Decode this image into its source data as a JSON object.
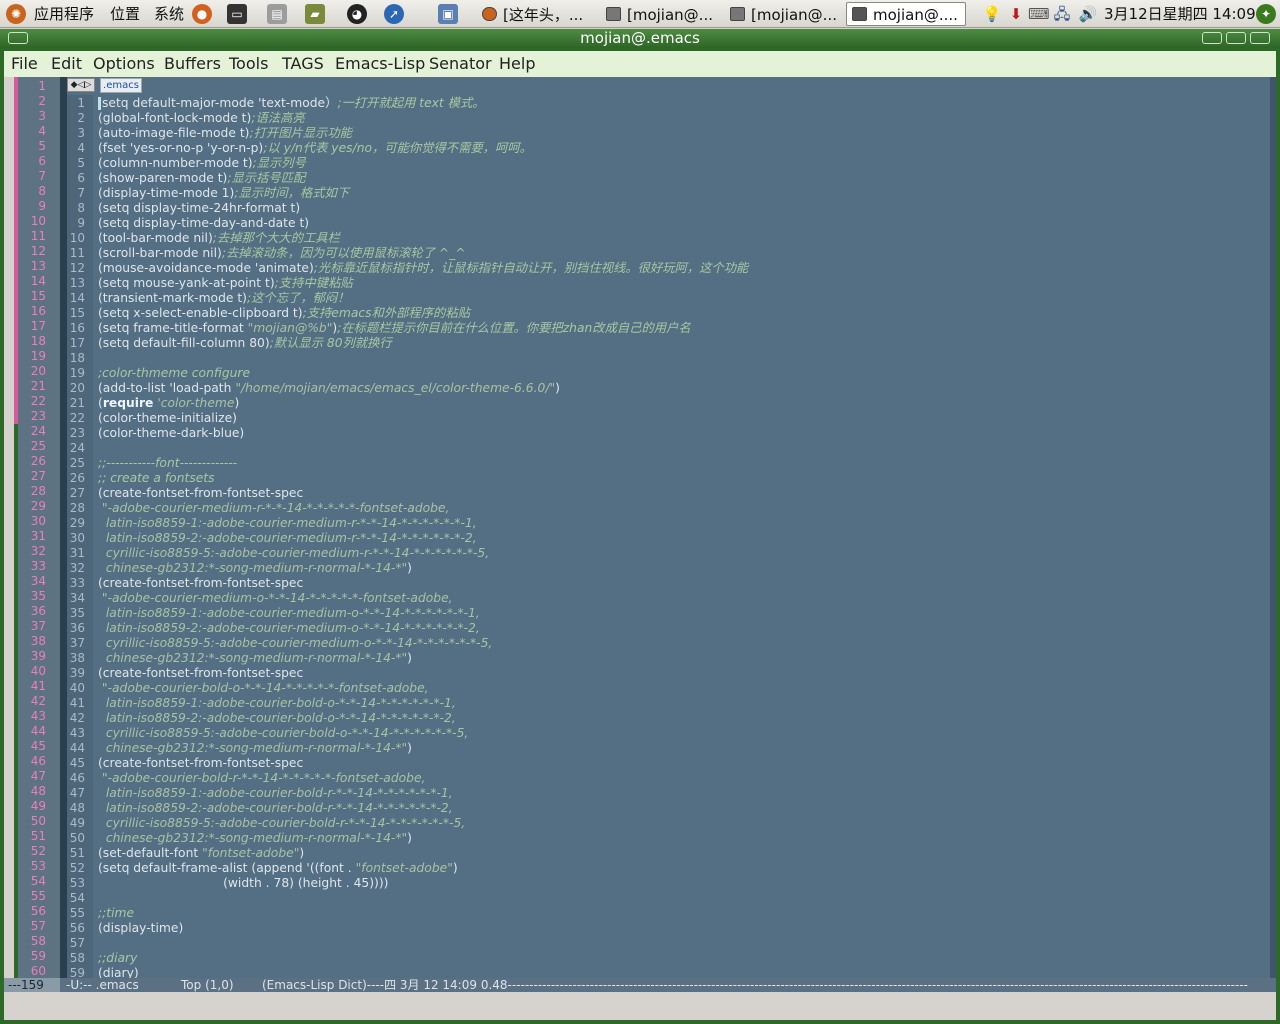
{
  "panel": {
    "apps_label": "应用程序",
    "places_label": "位置",
    "system_label": "系统",
    "tasks": [
      {
        "label": "[这年头，..."
      },
      {
        "label": "[mojian@..."
      },
      {
        "label": "[mojian@..."
      },
      {
        "label": "mojian@...."
      }
    ],
    "clock": "3月12日星期四 14:09"
  },
  "window": {
    "title": "mojian@.emacs"
  },
  "menubar": {
    "items": [
      "File",
      "Edit",
      "Options",
      "Buffers",
      "Tools",
      "TAGS",
      "Emacs-Lisp",
      "Senator",
      "Help"
    ]
  },
  "tab": {
    "label": ".emacs"
  },
  "outer_line_numbers": [
    "1",
    "2",
    "3",
    "4",
    "5",
    "6",
    "7",
    "8",
    "9",
    "10",
    "11",
    "12",
    "13",
    "14",
    "15",
    "16",
    "17",
    "18",
    "19",
    "20",
    "21",
    "22",
    "23",
    "24",
    "25",
    "26",
    "27",
    "28",
    "29",
    "30",
    "31",
    "32",
    "33",
    "34",
    "35",
    "36",
    "37",
    "38",
    "39",
    "40",
    "41",
    "42",
    "43",
    "44",
    "45",
    "46",
    "47",
    "48",
    "49",
    "50",
    "51",
    "52",
    "53",
    "54",
    "55",
    "56",
    "57",
    "58",
    "59",
    "60"
  ],
  "lines": [
    {
      "n": "1",
      "seg": [
        [
          "",
          "setq default-major-mode 'text-mode"
        ],
        [
          "",
          "）"
        ],
        [
          "cmt",
          ";一打开就起用 text 模式。"
        ]
      ]
    },
    {
      "n": "2",
      "seg": [
        [
          "",
          "(global-font-lock-mode t)"
        ],
        [
          "cmt",
          ";语法高亮"
        ]
      ]
    },
    {
      "n": "3",
      "seg": [
        [
          "",
          "(auto-image-file-mode t)"
        ],
        [
          "cmt",
          ";打开图片显示功能"
        ]
      ]
    },
    {
      "n": "4",
      "seg": [
        [
          "",
          "(fset 'yes-or-no-p 'y-or-n-p)"
        ],
        [
          "cmt",
          ";以 y/n代表 yes/no，可能你觉得不需要，呵呵。"
        ]
      ]
    },
    {
      "n": "5",
      "seg": [
        [
          "",
          "(column-number-mode t)"
        ],
        [
          "cmt",
          ";显示列号"
        ]
      ]
    },
    {
      "n": "6",
      "seg": [
        [
          "",
          "(show-paren-mode t)"
        ],
        [
          "cmt",
          ";显示括号匹配"
        ]
      ]
    },
    {
      "n": "7",
      "seg": [
        [
          "",
          "(display-time-mode 1)"
        ],
        [
          "cmt",
          ";显示时间，格式如下"
        ]
      ]
    },
    {
      "n": "8",
      "seg": [
        [
          "",
          "(setq display-time-24hr-format t)"
        ]
      ]
    },
    {
      "n": "9",
      "seg": [
        [
          "",
          "(setq display-time-day-and-date t)"
        ]
      ]
    },
    {
      "n": "10",
      "seg": [
        [
          "",
          "(tool-bar-mode nil)"
        ],
        [
          "cmt",
          ";去掉那个大大的工具栏"
        ]
      ]
    },
    {
      "n": "11",
      "seg": [
        [
          "",
          "(scroll-bar-mode nil)"
        ],
        [
          "cmt",
          ";去掉滚动条，因为可以使用鼠标滚轮了 ^_^"
        ]
      ]
    },
    {
      "n": "12",
      "seg": [
        [
          "",
          "(mouse-avoidance-mode 'animate)"
        ],
        [
          "cmt",
          ";光标靠近鼠标指针时，让鼠标指针自动让开，别挡住视线。很好玩阿，这个功能"
        ]
      ]
    },
    {
      "n": "13",
      "seg": [
        [
          "",
          "(setq mouse-yank-at-point t)"
        ],
        [
          "cmt",
          ";支持中键粘贴"
        ]
      ]
    },
    {
      "n": "14",
      "seg": [
        [
          "",
          "(transient-mark-mode t)"
        ],
        [
          "cmt",
          ";这个忘了，郁闷！"
        ]
      ]
    },
    {
      "n": "15",
      "seg": [
        [
          "",
          "(setq x-select-enable-clipboard t)"
        ],
        [
          "cmt",
          ";支持emacs和外部程序的粘贴"
        ]
      ]
    },
    {
      "n": "16",
      "seg": [
        [
          "",
          "(setq frame-title-format "
        ],
        [
          "str",
          "\"mojian@%b\""
        ],
        [
          "",
          ")"
        ],
        [
          "cmt",
          ";在标题栏提示你目前在什么位置。你要把zhan改成自己的用户名"
        ]
      ]
    },
    {
      "n": "17",
      "seg": [
        [
          "",
          "(setq default-fill-column 80)"
        ],
        [
          "cmt",
          ";默认显示 80列就换行"
        ]
      ]
    },
    {
      "n": "18",
      "seg": []
    },
    {
      "n": "19",
      "seg": [
        [
          "cmt",
          ";color-thmeme configure"
        ]
      ]
    },
    {
      "n": "20",
      "seg": [
        [
          "",
          "(add-to-list 'load-path "
        ],
        [
          "str",
          "\"/home/mojian/emacs/emacs_el/color-theme-6.6.0/\""
        ],
        [
          "",
          ")"
        ]
      ]
    },
    {
      "n": "21",
      "seg": [
        [
          "",
          "("
        ],
        [
          "kw",
          "require"
        ],
        [
          "str",
          " 'color-theme"
        ],
        [
          "",
          ")"
        ]
      ]
    },
    {
      "n": "22",
      "seg": [
        [
          "",
          "(color-theme-initialize)"
        ]
      ]
    },
    {
      "n": "23",
      "seg": [
        [
          "",
          "(color-theme-dark-blue)"
        ]
      ]
    },
    {
      "n": "24",
      "seg": []
    },
    {
      "n": "25",
      "seg": [
        [
          "cmt",
          ";;-----------font-------------"
        ]
      ]
    },
    {
      "n": "26",
      "seg": [
        [
          "cmt",
          ";; create a fontsets"
        ]
      ]
    },
    {
      "n": "27",
      "seg": [
        [
          "",
          "(create-fontset-from-fontset-spec"
        ]
      ]
    },
    {
      "n": "28",
      "seg": [
        [
          "str",
          " \"-adobe-courier-medium-r-*-*-14-*-*-*-*-*-fontset-adobe,"
        ]
      ]
    },
    {
      "n": "29",
      "seg": [
        [
          "str",
          "  latin-iso8859-1:-adobe-courier-medium-r-*-*-14-*-*-*-*-*-*-1,"
        ]
      ]
    },
    {
      "n": "30",
      "seg": [
        [
          "str",
          "  latin-iso8859-2:-adobe-courier-medium-r-*-*-14-*-*-*-*-*-*-2,"
        ]
      ]
    },
    {
      "n": "31",
      "seg": [
        [
          "str",
          "  cyrillic-iso8859-5:-adobe-courier-medium-r-*-*-14-*-*-*-*-*-*-5,"
        ]
      ]
    },
    {
      "n": "32",
      "seg": [
        [
          "str",
          "  chinese-gb2312:*-song-medium-r-normal-*-14-*\""
        ],
        [
          "",
          ")"
        ]
      ]
    },
    {
      "n": "33",
      "seg": [
        [
          "",
          "(create-fontset-from-fontset-spec"
        ]
      ]
    },
    {
      "n": "34",
      "seg": [
        [
          "str",
          " \"-adobe-courier-medium-o-*-*-14-*-*-*-*-*-fontset-adobe,"
        ]
      ]
    },
    {
      "n": "35",
      "seg": [
        [
          "str",
          "  latin-iso8859-1:-adobe-courier-medium-o-*-*-14-*-*-*-*-*-*-1,"
        ]
      ]
    },
    {
      "n": "36",
      "seg": [
        [
          "str",
          "  latin-iso8859-2:-adobe-courier-medium-o-*-*-14-*-*-*-*-*-*-2,"
        ]
      ]
    },
    {
      "n": "37",
      "seg": [
        [
          "str",
          "  cyrillic-iso8859-5:-adobe-courier-medium-o-*-*-14-*-*-*-*-*-*-5,"
        ]
      ]
    },
    {
      "n": "38",
      "seg": [
        [
          "str",
          "  chinese-gb2312:*-song-medium-r-normal-*-14-*\""
        ],
        [
          "",
          ")"
        ]
      ]
    },
    {
      "n": "39",
      "seg": [
        [
          "",
          "(create-fontset-from-fontset-spec"
        ]
      ]
    },
    {
      "n": "40",
      "seg": [
        [
          "str",
          " \"-adobe-courier-bold-o-*-*-14-*-*-*-*-*-fontset-adobe,"
        ]
      ]
    },
    {
      "n": "41",
      "seg": [
        [
          "str",
          "  latin-iso8859-1:-adobe-courier-bold-o-*-*-14-*-*-*-*-*-*-1,"
        ]
      ]
    },
    {
      "n": "42",
      "seg": [
        [
          "str",
          "  latin-iso8859-2:-adobe-courier-bold-o-*-*-14-*-*-*-*-*-*-2,"
        ]
      ]
    },
    {
      "n": "43",
      "seg": [
        [
          "str",
          "  cyrillic-iso8859-5:-adobe-courier-bold-o-*-*-14-*-*-*-*-*-*-5,"
        ]
      ]
    },
    {
      "n": "44",
      "seg": [
        [
          "str",
          "  chinese-gb2312:*-song-medium-r-normal-*-14-*\""
        ],
        [
          "",
          ")"
        ]
      ]
    },
    {
      "n": "45",
      "seg": [
        [
          "",
          "(create-fontset-from-fontset-spec"
        ]
      ]
    },
    {
      "n": "46",
      "seg": [
        [
          "str",
          " \"-adobe-courier-bold-r-*-*-14-*-*-*-*-*-fontset-adobe,"
        ]
      ]
    },
    {
      "n": "47",
      "seg": [
        [
          "str",
          "  latin-iso8859-1:-adobe-courier-bold-r-*-*-14-*-*-*-*-*-*-1,"
        ]
      ]
    },
    {
      "n": "48",
      "seg": [
        [
          "str",
          "  latin-iso8859-2:-adobe-courier-bold-r-*-*-14-*-*-*-*-*-*-2,"
        ]
      ]
    },
    {
      "n": "49",
      "seg": [
        [
          "str",
          "  cyrillic-iso8859-5:-adobe-courier-bold-r-*-*-14-*-*-*-*-*-*-5,"
        ]
      ]
    },
    {
      "n": "50",
      "seg": [
        [
          "str",
          "  chinese-gb2312:*-song-medium-r-normal-*-14-*\""
        ],
        [
          "",
          ")"
        ]
      ]
    },
    {
      "n": "51",
      "seg": [
        [
          "",
          "(set-default-font "
        ],
        [
          "str",
          "\"fontset-adobe\""
        ],
        [
          "",
          ")"
        ]
      ]
    },
    {
      "n": "52",
      "seg": [
        [
          "",
          "(setq default-frame-alist (append '((font . "
        ],
        [
          "str",
          "\"fontset-adobe\""
        ],
        [
          "",
          ")"
        ]
      ]
    },
    {
      "n": "53",
      "seg": [
        [
          "",
          "                                (width . 78) (height . 45))))"
        ]
      ]
    },
    {
      "n": "54",
      "seg": []
    },
    {
      "n": "55",
      "seg": [
        [
          "cmt",
          ";;time"
        ]
      ]
    },
    {
      "n": "56",
      "seg": [
        [
          "",
          "(display-time)"
        ]
      ]
    },
    {
      "n": "57",
      "seg": []
    },
    {
      "n": "58",
      "seg": [
        [
          "cmt",
          ";;diary"
        ]
      ]
    },
    {
      "n": "59",
      "seg": [
        [
          "",
          "(diary)"
        ]
      ]
    }
  ],
  "modeline": {
    "line_count": "---159",
    "status": "-U:--  .emacs",
    "position": "Top (1,0)",
    "mode": "(Emacs-Lisp Dict)----四  3月 12 14:09 0.48---------------------------------------------------------------------------------------------------------------------------------------------------------------------------"
  },
  "colors": {
    "frame": "#2e6a27",
    "menubar": "#e4f3d8",
    "buffer_bg": "#546f84",
    "line_number": "#ea7fb9",
    "comment": "#a9c7a1"
  }
}
